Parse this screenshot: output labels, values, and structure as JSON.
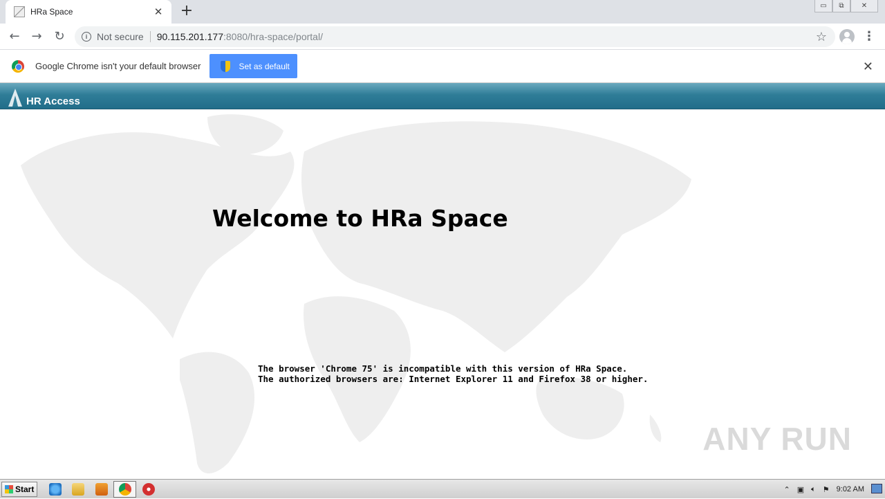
{
  "browser": {
    "tab": {
      "title": "HRa Space",
      "close_icon": "close-icon"
    },
    "new_tab_label": "+",
    "window_controls": {
      "minimize": "▭",
      "restore": "⧉",
      "close": "✕"
    },
    "nav": {
      "back": "←",
      "forward": "→",
      "reload": "↻"
    },
    "address": {
      "security_label": "Not secure",
      "host": "90.115.201.177",
      "rest": ":8080/hra-space/portal/"
    },
    "star": "☆",
    "menu": "⋮"
  },
  "infobar": {
    "message": "Google Chrome isn't your default browser",
    "button_label": "Set as default",
    "close": "✕"
  },
  "app": {
    "logo_text": "HR Access",
    "welcome": "Welcome to HRa Space",
    "message_line1": "The browser 'Chrome 75' is incompatible with this version of HRa Space.",
    "message_line2": "The authorized browsers are: Internet Explorer 11 and Firefox 38 or higher."
  },
  "watermark": "ANY RUN",
  "taskbar": {
    "start_label": "Start",
    "clock": "9:02 AM",
    "tray_icons": [
      "chevron-up-icon",
      "network-icon",
      "volume-icon",
      "flag-icon"
    ]
  }
}
